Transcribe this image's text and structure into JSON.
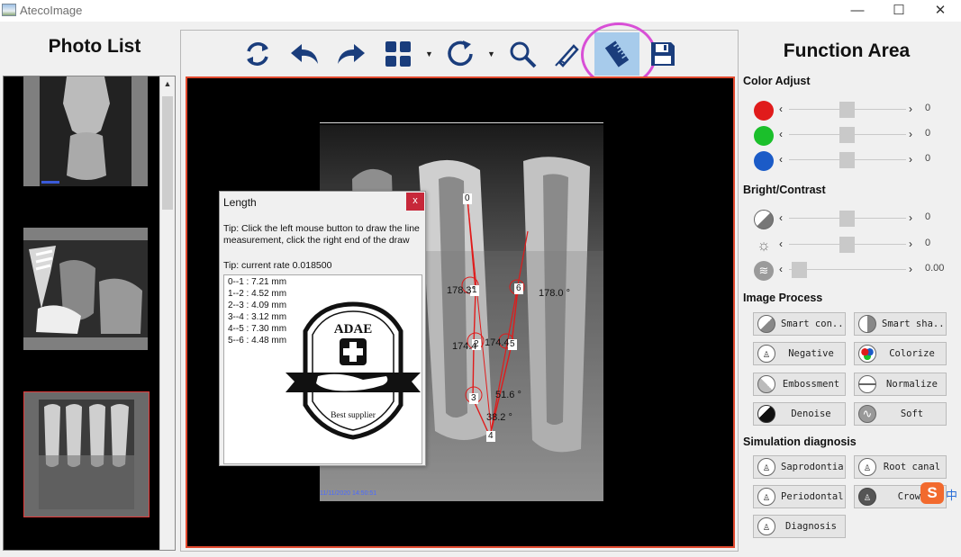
{
  "window": {
    "title": "AtecoImage",
    "min": "—",
    "max": "☐",
    "close": "✕"
  },
  "left_panel": {
    "header": "Photo List"
  },
  "right_panel": {
    "header": "Function Area"
  },
  "toolbar": {
    "tools": [
      "refresh-icon",
      "undo-icon",
      "redo-icon",
      "layout-grid-icon",
      "rotate-icon",
      "zoom-icon",
      "pen-icon",
      "ruler-icon",
      "save-icon"
    ],
    "active_tool": "ruler-icon",
    "accent": "#a7cbeb",
    "highlight_color": "#d84fd6"
  },
  "canvas": {
    "border_color": "#e24a2f",
    "labels": [
      "0",
      "1",
      "2",
      "3",
      "4",
      "5",
      "6"
    ],
    "angles": [
      "178.3°",
      "178.0 °",
      "174.4",
      "174.4",
      "51.6 °",
      "38.2 °"
    ],
    "date_stamp": "11/11/2020 14:50:51"
  },
  "length_dialog": {
    "title": "Length",
    "close": "x",
    "tip1": "Tip: Click the left mouse button to draw the line measurement, click the right end of the draw",
    "tip2": "Tip: current rate 0.018500",
    "measurements": [
      "0--1 : 7.21 mm",
      "1--2 : 4.52 mm",
      "2--3 : 4.09 mm",
      "3--4 : 3.12 mm",
      "4--5 : 7.30 mm",
      "5--6 : 4.48 mm"
    ],
    "stamp_top": "ADAE",
    "stamp_bottom": "Best supplier"
  },
  "color_adjust": {
    "title": "Color Adjust",
    "rows": [
      {
        "icon": "red-circle-icon",
        "color": "#e01b1b",
        "value": "0",
        "level": 0.5
      },
      {
        "icon": "green-circle-icon",
        "color": "#1bbf2b",
        "value": "0",
        "level": 0.5
      },
      {
        "icon": "blue-circle-icon",
        "color": "#1b5bc7",
        "value": "0",
        "level": 0.5
      }
    ]
  },
  "bright_contrast": {
    "title": "Bright/Contrast",
    "rows": [
      {
        "icon": "contrast-icon",
        "value": "0",
        "level": 0.5
      },
      {
        "icon": "brightness-icon",
        "value": "0",
        "level": 0.5
      },
      {
        "icon": "gamma-icon",
        "value": "0.00",
        "level": 0.08
      }
    ]
  },
  "image_process": {
    "title": "Image Process",
    "buttons": [
      {
        "label": "Smart con...",
        "icon": "smart-contrast-icon"
      },
      {
        "label": "Smart sha...",
        "icon": "smart-sharpen-icon"
      },
      {
        "label": "Negative",
        "icon": "negative-tooth-icon"
      },
      {
        "label": "Colorize",
        "icon": "colorize-icon"
      },
      {
        "label": "Embossment",
        "icon": "emboss-icon"
      },
      {
        "label": "Normalize",
        "icon": "normalize-icon"
      },
      {
        "label": "Denoise",
        "icon": "denoise-icon"
      },
      {
        "label": "Soft",
        "icon": "soft-icon"
      }
    ]
  },
  "simulation": {
    "title": "Simulation diagnosis",
    "buttons": [
      {
        "label": "Saprodontia",
        "icon": "tooth-icon"
      },
      {
        "label": "Root canal",
        "icon": "tooth-icon"
      },
      {
        "label": "Periodontal",
        "icon": "tooth-icon"
      },
      {
        "label": "Crown",
        "icon": "crown-icon"
      },
      {
        "label": "Diagnosis",
        "icon": "tooth-icon"
      }
    ]
  },
  "ime": {
    "logo": "S",
    "char": "中"
  }
}
